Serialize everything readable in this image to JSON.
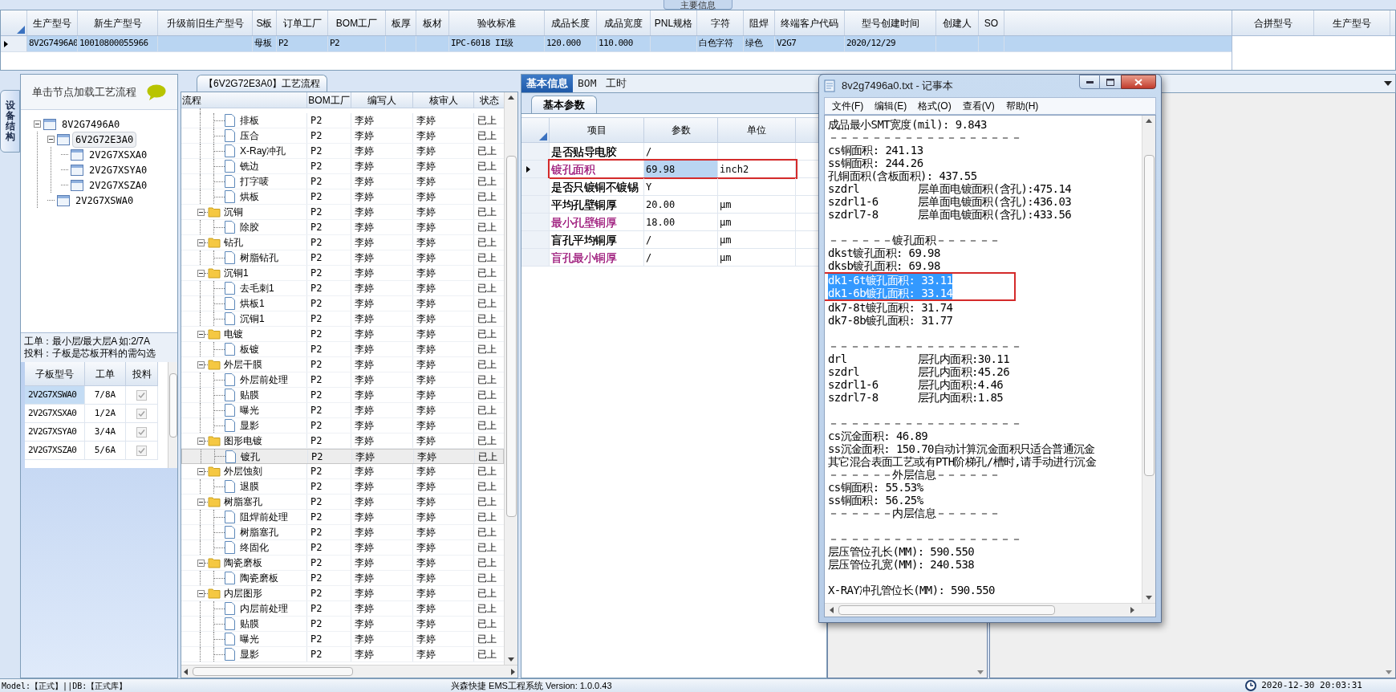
{
  "top_grid": {
    "title": "主要信息",
    "columns": [
      "生产型号",
      "新生产型号",
      "升级前旧生产型号",
      "S板",
      "订单工厂",
      "BOM工厂",
      "板厚",
      "板材",
      "验收标准",
      "成品长度",
      "成品宽度",
      "PNL规格",
      "字符",
      "阻焊",
      "终端客户代码",
      "型号创建时间",
      "创建人",
      "SO"
    ],
    "rows": [
      {
        "selected": true,
        "cells": [
          "8V2G7496A0",
          "10010800055966",
          "",
          "母板",
          "P2",
          "P2",
          "",
          "",
          "IPC-6018 II级",
          "120.000",
          "110.000",
          "",
          "白色字符",
          "绿色",
          "V2G7",
          "2020/12/29",
          "",
          ""
        ]
      }
    ],
    "side_columns": [
      "合拼型号",
      "生产型号"
    ]
  },
  "left_panel": {
    "side_tab": "设备结构",
    "header": "单击节点加载工艺流程",
    "tree": [
      {
        "label": "8V2G7496A0",
        "selected": false,
        "expanded": true,
        "children": [
          {
            "label": "6V2G72E3A0",
            "selected": true,
            "expanded": true,
            "children": [
              {
                "label": "2V2G7XSXA0",
                "selected": false
              },
              {
                "label": "2V2G7XSYA0",
                "selected": false
              },
              {
                "label": "2V2G7XSZA0",
                "selected": false
              }
            ]
          },
          {
            "label": "2V2G7XSWA0",
            "selected": false
          }
        ]
      }
    ],
    "note_lines": [
      "工单：最小层/最大层A 如:2/7A",
      "投料：子板是芯板开料的需勾选"
    ],
    "sub_table": {
      "columns": [
        "子板型号",
        "工单",
        "投料"
      ],
      "rows": [
        {
          "board": "2V2G7XSWA0",
          "order": "7/8A",
          "checked": true,
          "selected": true
        },
        {
          "board": "2V2G7XSXA0",
          "order": "1/2A",
          "checked": true,
          "selected": false
        },
        {
          "board": "2V2G7XSYA0",
          "order": "3/4A",
          "checked": true,
          "selected": false
        },
        {
          "board": "2V2G7XSZA0",
          "order": "5/6A",
          "checked": true,
          "selected": false
        }
      ]
    }
  },
  "flow": {
    "title": "【6V2G72E3A0】工艺流程",
    "columns": [
      "流程",
      "BOM工厂",
      "编写人",
      "核审人",
      "状态"
    ],
    "rows": [
      {
        "kind": "step",
        "name": "排板",
        "bom": "P2",
        "writer": "李婷",
        "reviewer": "李婷",
        "status": "已上",
        "selected": false
      },
      {
        "kind": "step",
        "name": "压合",
        "bom": "P2",
        "writer": "李婷",
        "reviewer": "李婷",
        "status": "已上",
        "selected": false
      },
      {
        "kind": "step",
        "name": "X-Ray冲孔",
        "bom": "P2",
        "writer": "李婷",
        "reviewer": "李婷",
        "status": "已上",
        "selected": false
      },
      {
        "kind": "step",
        "name": "铣边",
        "bom": "P2",
        "writer": "李婷",
        "reviewer": "李婷",
        "status": "已上",
        "selected": false
      },
      {
        "kind": "step",
        "name": "打字唛",
        "bom": "P2",
        "writer": "李婷",
        "reviewer": "李婷",
        "status": "已上",
        "selected": false
      },
      {
        "kind": "step",
        "name": "烘板",
        "bom": "P2",
        "writer": "李婷",
        "reviewer": "李婷",
        "status": "已上",
        "selected": false
      },
      {
        "kind": "group",
        "name": "沉铜",
        "bom": "P2",
        "writer": "李婷",
        "reviewer": "李婷",
        "status": "已上",
        "selected": false,
        "expanded": true,
        "children": [
          {
            "kind": "step",
            "name": "除胶",
            "bom": "P2",
            "writer": "李婷",
            "reviewer": "李婷",
            "status": "已上",
            "selected": false
          }
        ]
      },
      {
        "kind": "group",
        "name": "钻孔",
        "bom": "P2",
        "writer": "李婷",
        "reviewer": "李婷",
        "status": "已上",
        "selected": false,
        "expanded": true,
        "children": [
          {
            "kind": "step",
            "name": "树脂钻孔",
            "bom": "P2",
            "writer": "李婷",
            "reviewer": "李婷",
            "status": "已上",
            "selected": false
          }
        ]
      },
      {
        "kind": "group",
        "name": "沉铜1",
        "bom": "P2",
        "writer": "李婷",
        "reviewer": "李婷",
        "status": "已上",
        "selected": false,
        "expanded": true,
        "children": [
          {
            "kind": "step",
            "name": "去毛刺1",
            "bom": "P2",
            "writer": "李婷",
            "reviewer": "李婷",
            "status": "已上",
            "selected": false
          },
          {
            "kind": "step",
            "name": "烘板1",
            "bom": "P2",
            "writer": "李婷",
            "reviewer": "李婷",
            "status": "已上",
            "selected": false
          },
          {
            "kind": "step",
            "name": "沉铜1",
            "bom": "P2",
            "writer": "李婷",
            "reviewer": "李婷",
            "status": "已上",
            "selected": false
          }
        ]
      },
      {
        "kind": "group",
        "name": "电镀",
        "bom": "P2",
        "writer": "李婷",
        "reviewer": "李婷",
        "status": "已上",
        "selected": false,
        "expanded": true,
        "children": [
          {
            "kind": "step",
            "name": "板镀",
            "bom": "P2",
            "writer": "李婷",
            "reviewer": "李婷",
            "status": "已上",
            "selected": false
          }
        ]
      },
      {
        "kind": "group",
        "name": "外层干膜",
        "bom": "P2",
        "writer": "李婷",
        "reviewer": "李婷",
        "status": "已上",
        "selected": false,
        "expanded": true,
        "children": [
          {
            "kind": "step",
            "name": "外层前处理",
            "bom": "P2",
            "writer": "李婷",
            "reviewer": "李婷",
            "status": "已上",
            "selected": false
          },
          {
            "kind": "step",
            "name": "贴膜",
            "bom": "P2",
            "writer": "李婷",
            "reviewer": "李婷",
            "status": "已上",
            "selected": false
          },
          {
            "kind": "step",
            "name": "曝光",
            "bom": "P2",
            "writer": "李婷",
            "reviewer": "李婷",
            "status": "已上",
            "selected": false
          },
          {
            "kind": "step",
            "name": "显影",
            "bom": "P2",
            "writer": "李婷",
            "reviewer": "李婷",
            "status": "已上",
            "selected": false
          }
        ]
      },
      {
        "kind": "group",
        "name": "图形电镀",
        "bom": "P2",
        "writer": "李婷",
        "reviewer": "李婷",
        "status": "已上",
        "selected": false,
        "expanded": true,
        "children": [
          {
            "kind": "step",
            "name": "镀孔",
            "bom": "P2",
            "writer": "李婷",
            "reviewer": "李婷",
            "status": "已上",
            "selected": true
          }
        ]
      },
      {
        "kind": "group",
        "name": "外层蚀刻",
        "bom": "P2",
        "writer": "李婷",
        "reviewer": "李婷",
        "status": "已上",
        "selected": false,
        "expanded": true,
        "children": [
          {
            "kind": "step",
            "name": "退膜",
            "bom": "P2",
            "writer": "李婷",
            "reviewer": "李婷",
            "status": "已上",
            "selected": false
          }
        ]
      },
      {
        "kind": "group",
        "name": "树脂塞孔",
        "bom": "P2",
        "writer": "李婷",
        "reviewer": "李婷",
        "status": "已上",
        "selected": false,
        "expanded": true,
        "children": [
          {
            "kind": "step",
            "name": "阻焊前处理",
            "bom": "P2",
            "writer": "李婷",
            "reviewer": "李婷",
            "status": "已上",
            "selected": false
          },
          {
            "kind": "step",
            "name": "树脂塞孔",
            "bom": "P2",
            "writer": "李婷",
            "reviewer": "李婷",
            "status": "已上",
            "selected": false
          },
          {
            "kind": "step",
            "name": "终固化",
            "bom": "P2",
            "writer": "李婷",
            "reviewer": "李婷",
            "status": "已上",
            "selected": false
          }
        ]
      },
      {
        "kind": "group",
        "name": "陶瓷磨板",
        "bom": "P2",
        "writer": "李婷",
        "reviewer": "李婷",
        "status": "已上",
        "selected": false,
        "expanded": true,
        "children": [
          {
            "kind": "step",
            "name": "陶瓷磨板",
            "bom": "P2",
            "writer": "李婷",
            "reviewer": "李婷",
            "status": "已上",
            "selected": false
          }
        ]
      },
      {
        "kind": "group",
        "name": "内层图形",
        "bom": "P2",
        "writer": "李婷",
        "reviewer": "李婷",
        "status": "已上",
        "selected": false,
        "expanded": true,
        "children": [
          {
            "kind": "step",
            "name": "内层前处理",
            "bom": "P2",
            "writer": "李婷",
            "reviewer": "李婷",
            "status": "已上",
            "selected": false
          },
          {
            "kind": "step",
            "name": "贴膜",
            "bom": "P2",
            "writer": "李婷",
            "reviewer": "李婷",
            "status": "已上",
            "selected": false
          },
          {
            "kind": "step",
            "name": "曝光",
            "bom": "P2",
            "writer": "李婷",
            "reviewer": "李婷",
            "status": "已上",
            "selected": false
          },
          {
            "kind": "step",
            "name": "显影",
            "bom": "P2",
            "writer": "李婷",
            "reviewer": "李婷",
            "status": "已上",
            "selected": false
          }
        ]
      }
    ]
  },
  "detail": {
    "tabs": [
      {
        "label": "基本信息",
        "selected": true
      },
      {
        "label": "BOM",
        "selected": false
      },
      {
        "label": "工时",
        "selected": false
      }
    ],
    "sub_tab": "基本参数",
    "columns": [
      "项目",
      "参数",
      "单位"
    ],
    "rows": [
      {
        "item": "是否贴导电胶",
        "value": "/",
        "color": "#000000",
        "selected": false,
        "boxed": false
      },
      {
        "item": "镀孔面积",
        "value": "69.98",
        "unit": "inch2",
        "color": "#a0207f",
        "selected": true,
        "boxed": true
      },
      {
        "item": "是否只镀铜不镀锡",
        "value": "Y",
        "color": "#000000",
        "selected": false,
        "boxed": false
      },
      {
        "item": "平均孔壁铜厚",
        "value": "20.00",
        "unit": "μm",
        "color": "#000000",
        "selected": false,
        "boxed": false
      },
      {
        "item": "最小孔壁铜厚",
        "value": "18.00",
        "unit": "μm",
        "color": "#a0207f",
        "selected": false,
        "boxed": false
      },
      {
        "item": "盲孔平均铜厚",
        "value": "/",
        "unit": "μm",
        "color": "#000000",
        "selected": false,
        "boxed": false
      },
      {
        "item": "盲孔最小铜厚",
        "value": "/",
        "unit": "μm",
        "color": "#a0207f",
        "selected": false,
        "boxed": false
      }
    ]
  },
  "notepad": {
    "title": "8v2g7496a0.txt - 记事本",
    "menu": [
      "文件(F)",
      "编辑(E)",
      "格式(O)",
      "查看(V)",
      "帮助(H)"
    ],
    "lines": [
      {
        "kind": "text",
        "text": "成品最小SMT宽度(mil): 9.843"
      },
      {
        "kind": "text",
        "text": "－－－－－－－－－－－－－－－－－－"
      },
      {
        "kind": "text",
        "text": "cs铜面积: 241.13"
      },
      {
        "kind": "text",
        "text": "ss铜面积: 244.26"
      },
      {
        "kind": "text",
        "text": "孔铜面积(含板面积): 437.55"
      },
      {
        "kind": "pair",
        "label": "szdrl",
        "value": "层单面电镀面积(含孔):475.14"
      },
      {
        "kind": "pair",
        "label": "szdrl1-6",
        "value": "层单面电镀面积(含孔):436.03"
      },
      {
        "kind": "pair",
        "label": "szdrl7-8",
        "value": "层单面电镀面积(含孔):433.56"
      },
      {
        "kind": "blank"
      },
      {
        "kind": "text",
        "text": "－－－－－－镀孔面积－－－－－－"
      },
      {
        "kind": "text",
        "text": "dkst镀孔面积: 69.98"
      },
      {
        "kind": "text",
        "text": "dksb镀孔面积: 69.98"
      },
      {
        "kind": "box",
        "selected": true,
        "lines": [
          "dk1-6t镀孔面积: 33.11",
          "dk1-6b镀孔面积: 33.14"
        ]
      },
      {
        "kind": "text",
        "text": "dk7-8t镀孔面积: 31.74"
      },
      {
        "kind": "text",
        "text": "dk7-8b镀孔面积: 31.77"
      },
      {
        "kind": "blank"
      },
      {
        "kind": "text",
        "text": "－－－－－－－－－－－－－－－－－－"
      },
      {
        "kind": "pair",
        "label": "drl",
        "value": "层孔内面积:30.11"
      },
      {
        "kind": "pair",
        "label": "szdrl",
        "value": "层孔内面积:45.26"
      },
      {
        "kind": "pair",
        "label": "szdrl1-6",
        "value": "层孔内面积:4.46"
      },
      {
        "kind": "pair",
        "label": "szdrl7-8",
        "value": "层孔内面积:1.85"
      },
      {
        "kind": "blank"
      },
      {
        "kind": "text",
        "text": "－－－－－－－－－－－－－－－－－－"
      },
      {
        "kind": "text",
        "text": "cs沉金面积: 46.89"
      },
      {
        "kind": "text",
        "text": "ss沉金面积: 150.70自动计算沉金面积只适合普通沉金"
      },
      {
        "kind": "text",
        "text": "其它混合表面工艺或有PTH阶梯孔/槽时,请手动进行沉金"
      },
      {
        "kind": "text",
        "text": "－－－－－－外层信息－－－－－－"
      },
      {
        "kind": "text",
        "text": "cs铜面积: 55.53%"
      },
      {
        "kind": "text",
        "text": "ss铜面积: 56.25%"
      },
      {
        "kind": "text",
        "text": "－－－－－－内层信息－－－－－－"
      },
      {
        "kind": "blank"
      },
      {
        "kind": "text",
        "text": "－－－－－－－－－－－－－－－－－－"
      },
      {
        "kind": "text",
        "text": "层压管位孔长(MM): 590.550"
      },
      {
        "kind": "text",
        "text": "层压管位孔宽(MM): 240.538"
      },
      {
        "kind": "blank"
      },
      {
        "kind": "text",
        "text": "X-RAY冲孔管位长(MM): 590.550"
      }
    ]
  },
  "status_bar": {
    "left": "Model:【正式】||DB:【正式库】",
    "center": "兴森快捷 EMS工程系统 Version: 1.0.0.43",
    "time": "2020-12-30 20:03:31"
  }
}
